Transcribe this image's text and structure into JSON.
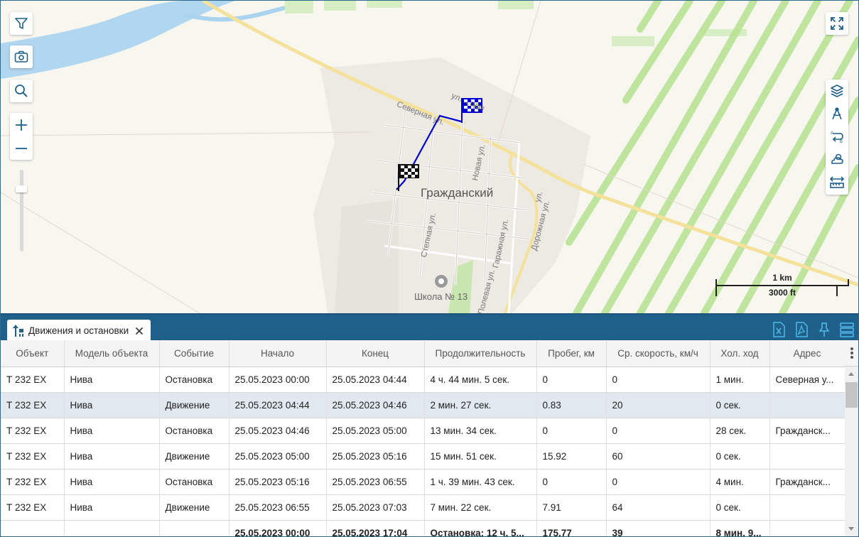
{
  "map": {
    "town": "Гражданский",
    "streets": [
      "Северная ул.",
      "ул. ...оды",
      "Новая ул.",
      "Степная ул.",
      "Гаражная ул.",
      "Полевая ул.",
      "Дорожная ул.",
      "ул."
    ],
    "school": "Школа № 13",
    "scale": {
      "top": "1 km",
      "bottom": "3000 ft"
    },
    "track_color": "#0000cc"
  },
  "toolbar_left": [
    "filter-icon",
    "camera-icon",
    "search-icon",
    "zoom-in-icon",
    "zoom-out-icon"
  ],
  "toolbar_right": [
    "fullscreen-icon",
    "layers-icon",
    "measure-icon",
    "route-icon",
    "weather-icon",
    "ruler-icon"
  ],
  "panel": {
    "tab_label": "Движения и остановки",
    "actions": [
      "excel-icon",
      "pdf-icon",
      "pin-icon",
      "list-icon"
    ],
    "columns": [
      "Объект",
      "Модель объекта",
      "Событие",
      "Начало",
      "Конец",
      "Продолжительность",
      "Пробег, км",
      "Ср. скорость, км/ч",
      "Хол. ход",
      "Адрес"
    ],
    "rows": [
      [
        "Т 232 ЕХ",
        "Нива",
        "Остановка",
        "25.05.2023 00:00",
        "25.05.2023 04:44",
        "4 ч. 44 мин. 5 сек.",
        "0",
        "0",
        "1 мин.",
        "Северная у..."
      ],
      [
        "Т 232 ЕХ",
        "Нива",
        "Движение",
        "25.05.2023 04:44",
        "25.05.2023 04:46",
        "2 мин. 27 сек.",
        "0.83",
        "20",
        "0 сек.",
        ""
      ],
      [
        "Т 232 ЕХ",
        "Нива",
        "Остановка",
        "25.05.2023 04:46",
        "25.05.2023 05:00",
        "13 мин. 34 сек.",
        "0",
        "0",
        "28 сек.",
        "Гражданск..."
      ],
      [
        "Т 232 ЕХ",
        "Нива",
        "Движение",
        "25.05.2023 05:00",
        "25.05.2023 05:16",
        "15 мин. 51 сек.",
        "15.92",
        "60",
        "0 сек.",
        ""
      ],
      [
        "Т 232 ЕХ",
        "Нива",
        "Остановка",
        "25.05.2023 05:16",
        "25.05.2023 06:55",
        "1 ч. 39 мин. 43 сек.",
        "0",
        "0",
        "4 мин.",
        "Гражданск..."
      ],
      [
        "Т 232 ЕХ",
        "Нива",
        "Движение",
        "25.05.2023 06:55",
        "25.05.2023 07:03",
        "7 мин. 22 сек.",
        "7.91",
        "64",
        "0 сек.",
        ""
      ]
    ],
    "totals": [
      "",
      "",
      "",
      "25.05.2023 00:00",
      "25.05.2023 17:04",
      "Остановка: 12 ч. 5...",
      "175.77",
      "39",
      "8 мин. 9...",
      ""
    ],
    "selected_row": 1
  }
}
